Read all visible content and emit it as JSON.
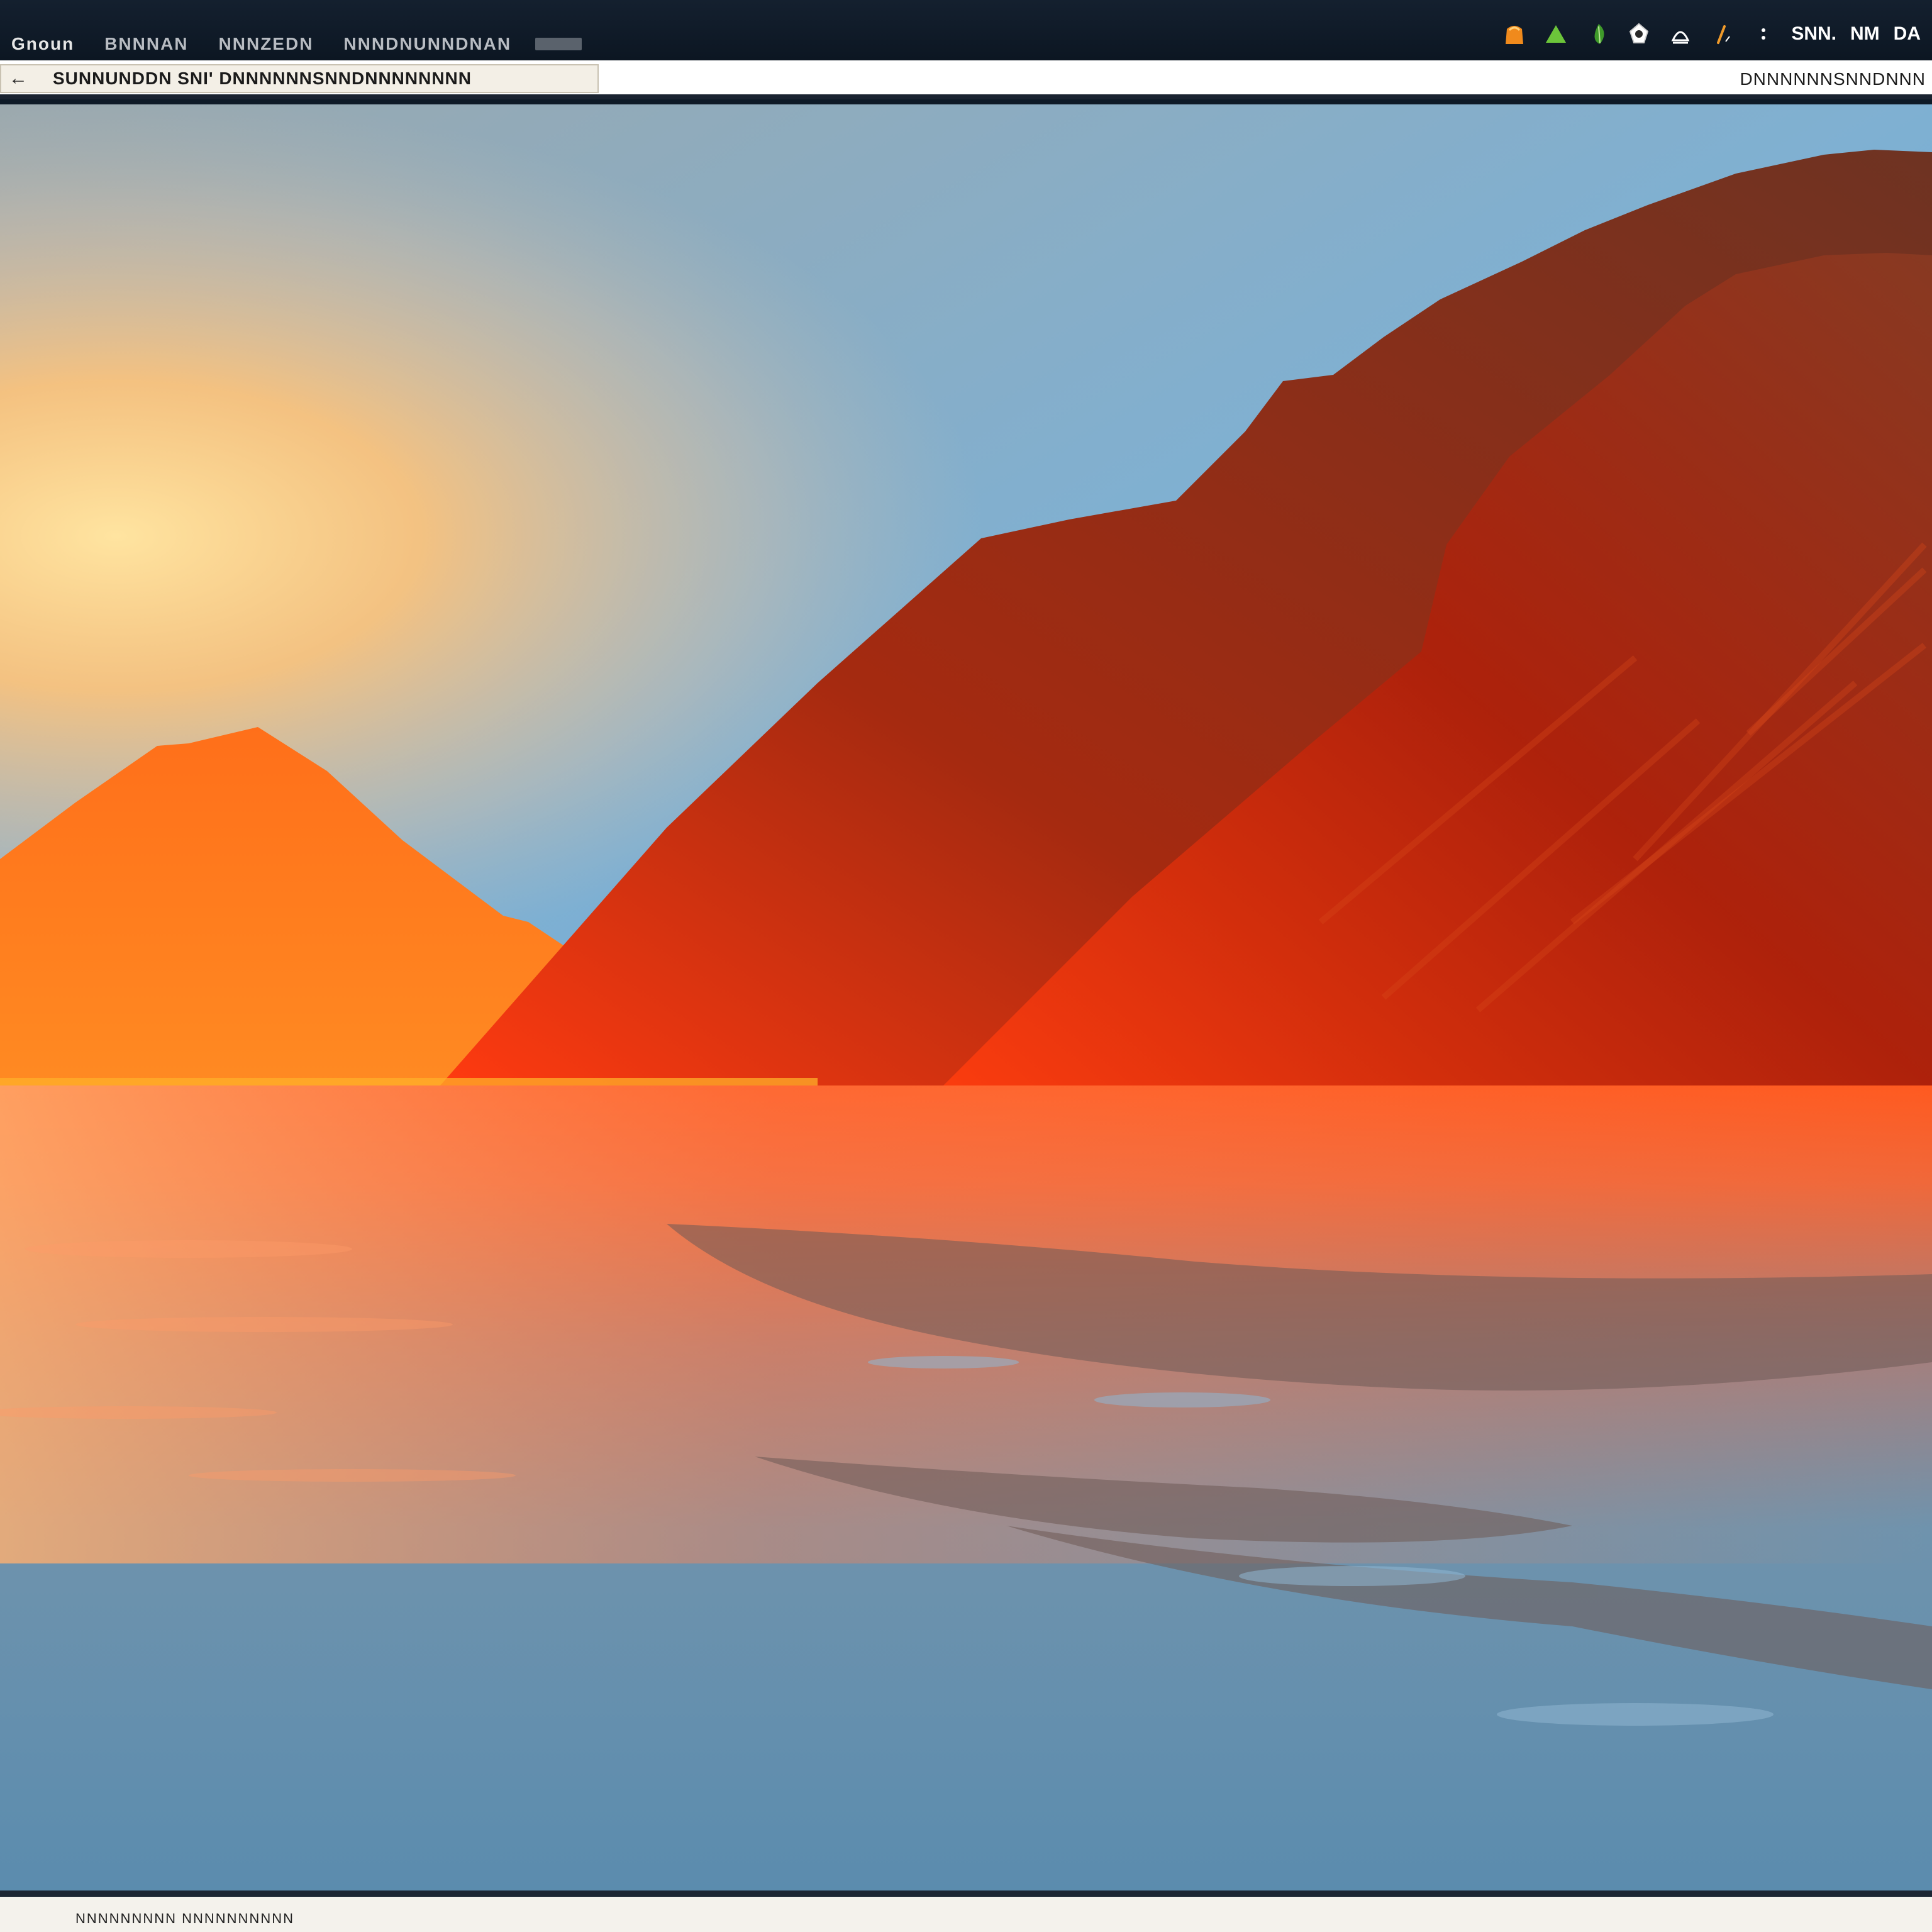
{
  "menu": {
    "items": [
      "Gnoun",
      "BNNNAN",
      "NNNZEDN",
      "NNNDNUNNDNAN"
    ]
  },
  "tray": {
    "icons": [
      "orange-tray-icon",
      "green-triangle-icon",
      "green-leaf-icon",
      "shield-icon",
      "eject-icon",
      "pen-icon",
      "dots-icon"
    ],
    "texts": [
      "SNN.",
      "NM",
      "DA"
    ]
  },
  "address": {
    "back_glyph": "←",
    "left_text": "SUNNUNDDN SNI'    DNNNNNNSNNDNNNNNNNN",
    "right_text": "DNNNNNNSNNDNNN"
  },
  "bottom": {
    "text": "NNNNNNNNN   NNNNNNNNNN"
  },
  "colors": {
    "top_bar": "#0e1a27",
    "sky_top": "#5ea6dd",
    "sky_glow": "#ffd690",
    "mountain_left": "#ff7a1e",
    "mountain_right": "#b3260e",
    "water_reflection": "#ff5a22",
    "water_deep": "#5b8cae"
  }
}
